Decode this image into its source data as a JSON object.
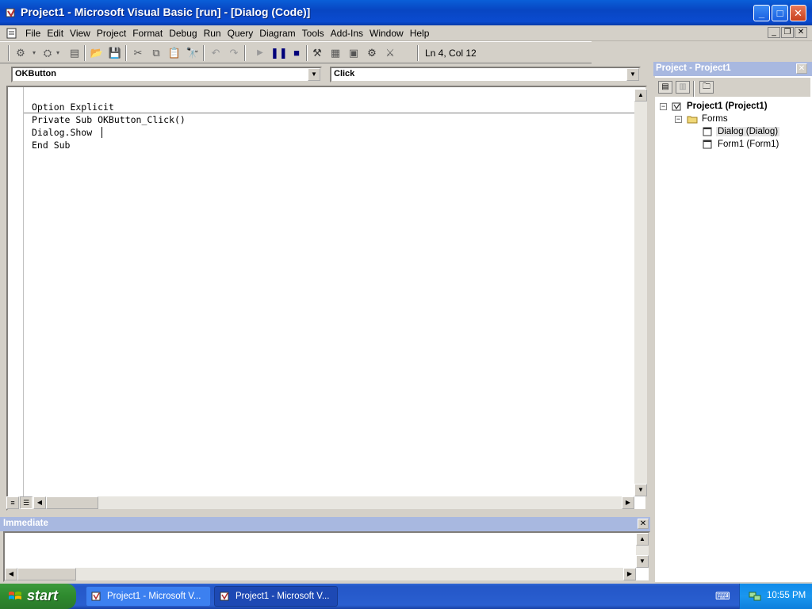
{
  "window": {
    "title": "Project1 - Microsoft Visual Basic [run] - [Dialog (Code)]",
    "min_symbol": "_",
    "max_symbol": "□",
    "close_symbol": "✕"
  },
  "menu": {
    "items": [
      "File",
      "Edit",
      "View",
      "Project",
      "Format",
      "Debug",
      "Run",
      "Query",
      "Diagram",
      "Tools",
      "Add-Ins",
      "Window",
      "Help"
    ],
    "mdi_min": "_",
    "mdi_restore": "❐",
    "mdi_close": "✕"
  },
  "toolbar": {
    "status": "Ln 4, Col 12",
    "icons": [
      "add-project-icon",
      "add-form-icon",
      "menu-editor-icon",
      "open-icon",
      "save-icon",
      "cut-icon",
      "copy-icon",
      "paste-icon",
      "find-icon",
      "undo-icon",
      "redo-icon",
      "start-icon",
      "break-icon",
      "end-icon",
      "project-explorer-icon",
      "properties-icon",
      "form-layout-icon",
      "object-browser-icon",
      "toolbox-icon"
    ]
  },
  "code_window": {
    "object_combo": "OKButton",
    "procedure_combo": "Click",
    "lines": [
      "Option Explicit",
      "Private Sub OKButton_Click()",
      "Dialog.Show",
      "End Sub"
    ]
  },
  "project_panel": {
    "title": "Project - Project1",
    "tree": {
      "root": "Project1 (Project1)",
      "folder": "Forms",
      "items": [
        "Dialog (Dialog)",
        "Form1 (Form1)"
      ]
    }
  },
  "immediate": {
    "title": "Immediate"
  },
  "taskbar": {
    "start_label": "start",
    "tasks": [
      "Project1 - Microsoft V...",
      "Project1 - Microsoft V..."
    ],
    "clock": "10:55 PM"
  }
}
